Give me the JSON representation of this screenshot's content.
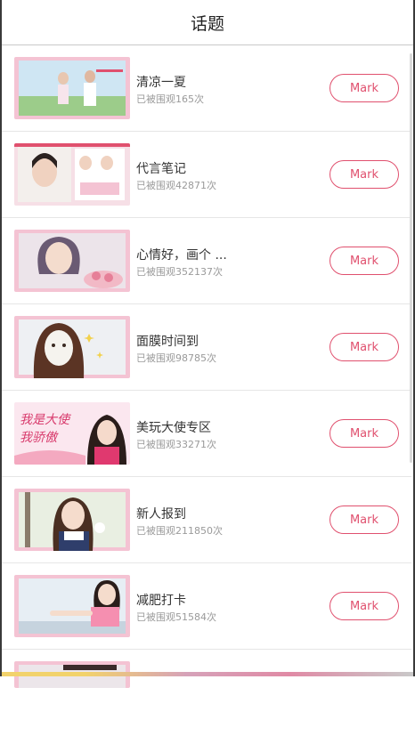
{
  "header": {
    "title": "话题"
  },
  "topics": [
    {
      "title": "清凉一夏",
      "views": "已被围观165次",
      "button": "Mark",
      "thumb_icon": "summer-couple-photo"
    },
    {
      "title": "代言笔记",
      "views": "已被围观42871次",
      "button": "Mark",
      "thumb_icon": "endorsement-notes-photo"
    },
    {
      "title": "心情好，画个 ...",
      "views": "已被围观352137次",
      "button": "Mark",
      "thumb_icon": "mood-makeup-photo"
    },
    {
      "title": "面膜时间到",
      "views": "已被围观98785次",
      "button": "Mark",
      "thumb_icon": "face-mask-photo"
    },
    {
      "title": "美玩大使专区",
      "views": "已被围观33271次",
      "button": "Mark",
      "thumb_icon": "ambassador-photo",
      "thumb_text": "我是大使 我骄傲"
    },
    {
      "title": "新人报到",
      "views": "已被围观211850次",
      "button": "Mark",
      "thumb_icon": "newcomer-photo"
    },
    {
      "title": "减肥打卡",
      "views": "已被围观51584次",
      "button": "Mark",
      "thumb_icon": "fitness-checkin-photo"
    }
  ],
  "colors": {
    "accent": "#e0506e",
    "thumb_border": "#f4c3d3",
    "divider": "#e6e6e6"
  }
}
